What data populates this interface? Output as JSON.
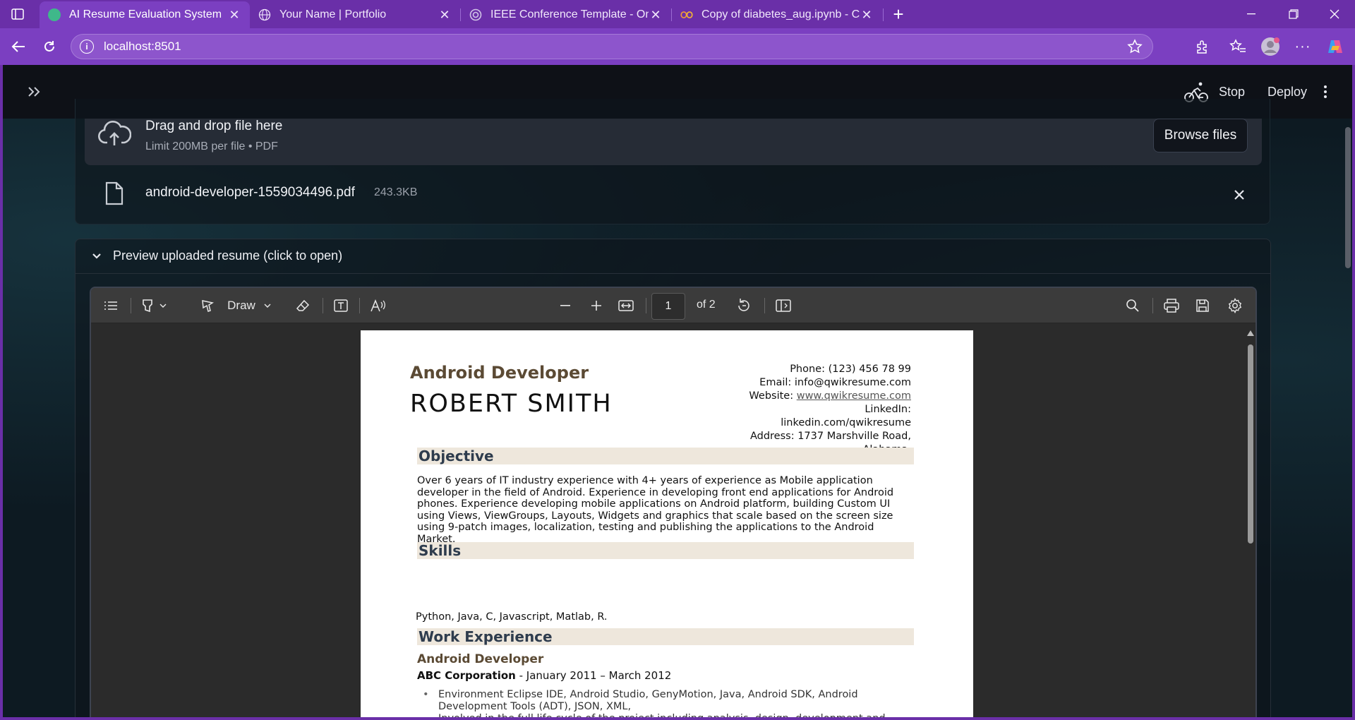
{
  "browser": {
    "tabs": [
      {
        "title": "AI Resume Evaluation System",
        "active": true,
        "icon": "streamlit-favicon"
      },
      {
        "title": "Your Name | Portfolio",
        "active": false,
        "icon": "globe-icon"
      },
      {
        "title": "IEEE Conference Template - Online",
        "active": false,
        "icon": "overleaf-favicon"
      },
      {
        "title": "Copy of diabetes_aug.ipynb - Cola",
        "active": false,
        "icon": "colab-favicon"
      }
    ],
    "url": "localhost:8501",
    "colors": {
      "chrome": "#6a2fa8",
      "toolbar": "#7b3fc1"
    }
  },
  "app_header": {
    "stop_label": "Stop",
    "deploy_label": "Deploy"
  },
  "uploader": {
    "title": "Drag and drop file here",
    "limit": "Limit 200MB per file • PDF",
    "browse_label": "Browse files",
    "file_name": "android-developer-1559034496.pdf",
    "file_size": "243.3KB"
  },
  "expander": {
    "label": "Preview uploaded resume (click to open)"
  },
  "pdf_toolbar": {
    "draw_label": "Draw",
    "page_number": "1",
    "page_of": "of 2"
  },
  "resume": {
    "role": "Android Developer",
    "name": "ROBERT SMITH",
    "contact": {
      "phone": "Phone: (123) 456 78 99",
      "email": "Email: info@qwikresume.com",
      "website_prefix": "Website: ",
      "website": "www.qwikresume.com",
      "linkedin_label": "LinkedIn:",
      "linkedin": "linkedin.com/qwikresume",
      "address1": "Address: 1737 Marshville Road,",
      "address2": "Alabama."
    },
    "objective_heading": "Objective",
    "objective_text": "Over 6 years of IT industry experience with 4+ years of experience as Mobile application developer in the field of Android. Experience in developing front end applications for Android phones. Experience developing mobile applications on Android platform, building Custom UI using Views, ViewGroups, Layouts, Widgets and graphics that scale based on the screen size using 9-patch images, localization, testing and publishing the applications to the Android Market.",
    "skills_heading": "Skills",
    "skills_text": "Python, Java, C, Javascript, Matlab, R.",
    "work_heading": "Work Experience",
    "job_title": "Android Developer",
    "company": "ABC Corporation",
    "dates": " - January 2011 – March 2012",
    "bullet1": "Environment Eclipse IDE, Android Studio, GenyMotion, Java, Android SDK, Android Development Tools (ADT), JSON, XML,",
    "bullet2": "Involved in the full life cycle of the project including analysis, design, development and deploym"
  }
}
